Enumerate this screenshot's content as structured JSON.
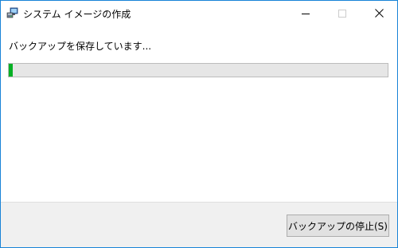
{
  "window": {
    "title": "システム イメージの作成"
  },
  "main": {
    "message": "バックアップを保存しています...",
    "progress": 0.01
  },
  "footer": {
    "stop_button_label": "バックアップの停止(S)"
  },
  "colors": {
    "progress_fill": "#06b025",
    "progress_track": "#e6e6e6",
    "window_border": "#1883d7",
    "footer_bg": "#f0f0f0"
  },
  "icons": {
    "app": "system-image-icon",
    "minimize": "minimize-icon",
    "maximize": "maximize-icon",
    "close": "close-icon"
  }
}
